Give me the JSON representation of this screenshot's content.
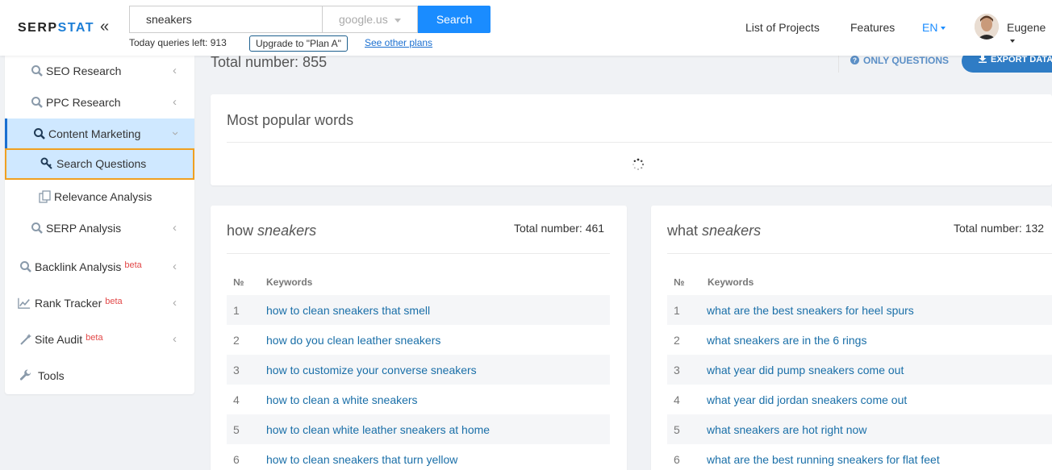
{
  "header": {
    "logo_main": "SERP",
    "logo_accent": "STAT",
    "search_value": "sneakers",
    "engine": "google.us",
    "search_button": "Search",
    "queries_left": "Today queries left: 913",
    "upgrade_button": "Upgrade to \"Plan A\"",
    "other_plans": "See other plans",
    "nav_projects": "List of Projects",
    "nav_features": "Features",
    "lang": "EN",
    "user": "Eugene"
  },
  "sidebar": {
    "items": [
      {
        "label": "SEO Research"
      },
      {
        "label": "PPC Research"
      },
      {
        "label": "Content Marketing"
      },
      {
        "label": "Search Questions"
      },
      {
        "label": "Relevance Analysis"
      },
      {
        "label": "SERP Analysis"
      },
      {
        "label": "Backlink Analysis",
        "badge": "beta"
      },
      {
        "label": "Rank Tracker",
        "badge": "beta"
      },
      {
        "label": "Site Audit",
        "badge": "beta"
      },
      {
        "label": "Tools"
      }
    ]
  },
  "main": {
    "total_number": "Total number: 855",
    "only_questions": "ONLY QUESTIONS",
    "export": "EXPORT DATA",
    "popular_title": "Most popular words",
    "tables": [
      {
        "prefix": "how",
        "query": "sneakers",
        "total": "Total number: 461",
        "col_num": "№",
        "col_kw": "Keywords",
        "rows": [
          {
            "n": "1",
            "kw": "how to clean sneakers that smell"
          },
          {
            "n": "2",
            "kw": "how do you clean leather sneakers"
          },
          {
            "n": "3",
            "kw": "how to customize your converse sneakers"
          },
          {
            "n": "4",
            "kw": "how to clean a white sneakers"
          },
          {
            "n": "5",
            "kw": "how to clean white leather sneakers at home"
          },
          {
            "n": "6",
            "kw": "how to clean sneakers that turn yellow"
          }
        ]
      },
      {
        "prefix": "what",
        "query": "sneakers",
        "total": "Total number: 132",
        "col_num": "№",
        "col_kw": "Keywords",
        "rows": [
          {
            "n": "1",
            "kw": "what are the best sneakers for heel spurs"
          },
          {
            "n": "2",
            "kw": "what sneakers are in the 6 rings"
          },
          {
            "n": "3",
            "kw": "what year did pump sneakers come out"
          },
          {
            "n": "4",
            "kw": "what year did jordan sneakers come out"
          },
          {
            "n": "5",
            "kw": "what sneakers are hot right now"
          },
          {
            "n": "6",
            "kw": "what are the best running sneakers for flat feet"
          }
        ]
      }
    ]
  },
  "colors": {
    "accent": "#1a8cff",
    "link": "#1a6fa8",
    "beta": "#e24848",
    "highlight_outline": "#f0a020"
  }
}
